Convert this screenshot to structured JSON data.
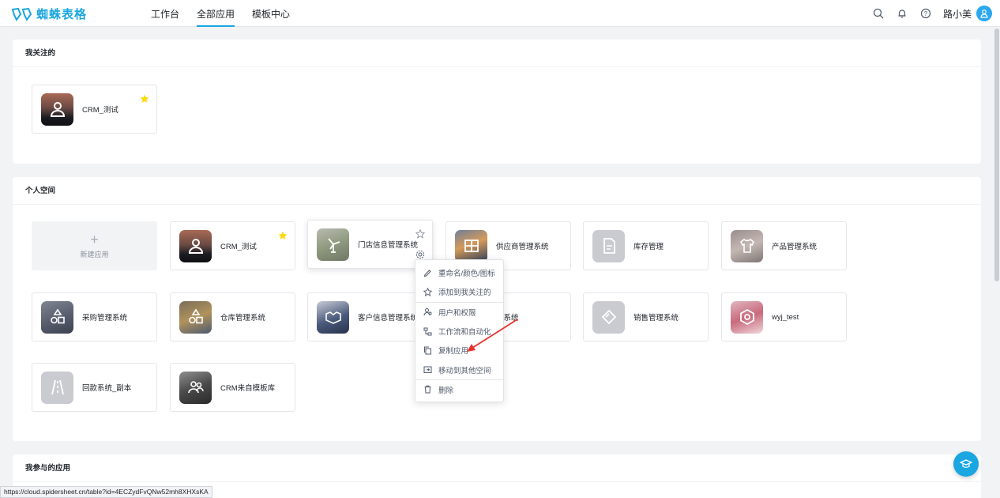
{
  "header": {
    "logo_text": "蜘蛛表格",
    "nav": [
      "工作台",
      "全部应用",
      "模板中心"
    ],
    "active_nav": "全部应用",
    "user_name": "路小美"
  },
  "sections": {
    "favorites": {
      "title": "我关注的",
      "apps": [
        {
          "name": "CRM_测试",
          "starred": true
        }
      ]
    },
    "personal": {
      "title": "个人空间",
      "new_app_label": "新建应用",
      "apps": [
        {
          "name": "CRM_测试",
          "starred": true
        },
        {
          "name": "门店信息管理系统",
          "starred": false
        },
        {
          "name": "供应商管理系统"
        },
        {
          "name": "库存管理"
        },
        {
          "name": "产品管理系统"
        },
        {
          "name": "采购管理系统"
        },
        {
          "name": "仓库管理系统"
        },
        {
          "name": "客户信息管理系统"
        },
        {
          "name": "款系统"
        },
        {
          "name": "销售管理系统"
        },
        {
          "name": "wyj_test"
        },
        {
          "name": "回款系统_副本"
        },
        {
          "name": "CRM来自模板库"
        }
      ]
    },
    "participated": {
      "title": "我参与的应用"
    }
  },
  "context_menu": {
    "items": [
      {
        "label": "重命名/颜色/图标",
        "icon": "pencil-icon"
      },
      {
        "label": "添加到我关注的",
        "icon": "star-outline-icon"
      },
      {
        "label": "用户和权限",
        "icon": "users-icon"
      },
      {
        "label": "工作流和自动化",
        "icon": "workflow-icon"
      },
      {
        "label": "复制应用",
        "icon": "copy-icon"
      },
      {
        "label": "移动到其他空间",
        "icon": "move-icon"
      },
      {
        "label": "删除",
        "icon": "trash-icon"
      }
    ]
  },
  "status_url": "https://cloud.spidersheet.cn/table?id=4ECZydFvQNw52mh8XHXsKA",
  "colors": {
    "accent": "#1aa6e0",
    "star": "#fadb14",
    "arrow": "#e8332e"
  }
}
